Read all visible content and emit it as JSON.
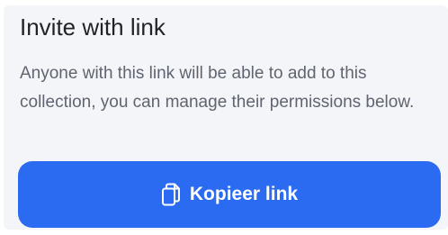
{
  "invite": {
    "title": "Invite with link",
    "description": "Anyone with this link will be able to add to this collection, you can manage their permissions below.",
    "button_label": "Kopieer link",
    "button_icon": "copy-icon"
  },
  "colors": {
    "card_background": "#f4f5f8",
    "title_text": "#1f2329",
    "description_text": "#5f6570",
    "button_background": "#2a6bf2",
    "button_text": "#ffffff"
  }
}
